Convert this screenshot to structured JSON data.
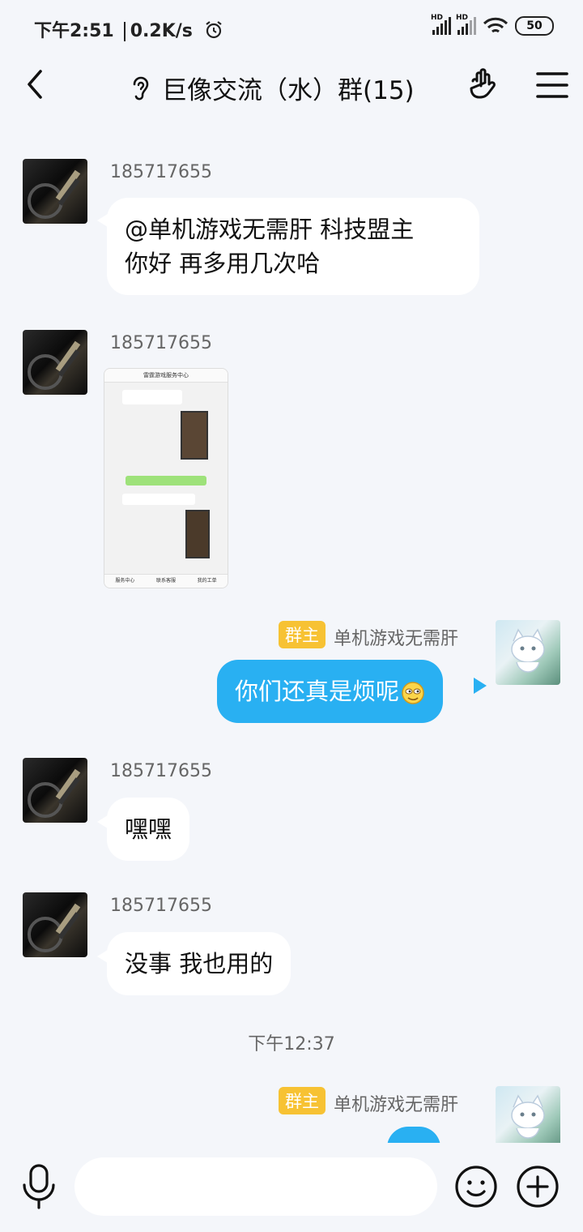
{
  "status_bar": {
    "time": "下午2:51",
    "speed": "0.2K/s",
    "signal_label": "HD",
    "battery": "50"
  },
  "header": {
    "title": "巨像交流（水）群(15)"
  },
  "messages": [
    {
      "sender": "185717655",
      "text_line1": "@单机游戏无需肝 科技盟主",
      "text_line2": "你好 再多用几次哈"
    },
    {
      "sender": "185717655",
      "image_title": "雷霆游戏服务中心",
      "image_footer": [
        "服务中心",
        "联系客服",
        "我的工单"
      ]
    },
    {
      "badge": "群主",
      "sender": "单机游戏无需肝",
      "text": "你们还真是烦呢"
    },
    {
      "sender": "185717655",
      "text": "嘿嘿"
    },
    {
      "sender": "185717655",
      "text": "没事 我也用的"
    },
    {
      "badge": "群主",
      "sender": "单机游戏无需肝",
      "text": ""
    }
  ],
  "timestamp": "下午12:37",
  "input": {
    "placeholder": ""
  },
  "icons": [
    "back-arrow-icon",
    "ear-icon",
    "hand-icon",
    "menu-icon",
    "microphone-icon",
    "emoji-icon",
    "plus-icon"
  ]
}
